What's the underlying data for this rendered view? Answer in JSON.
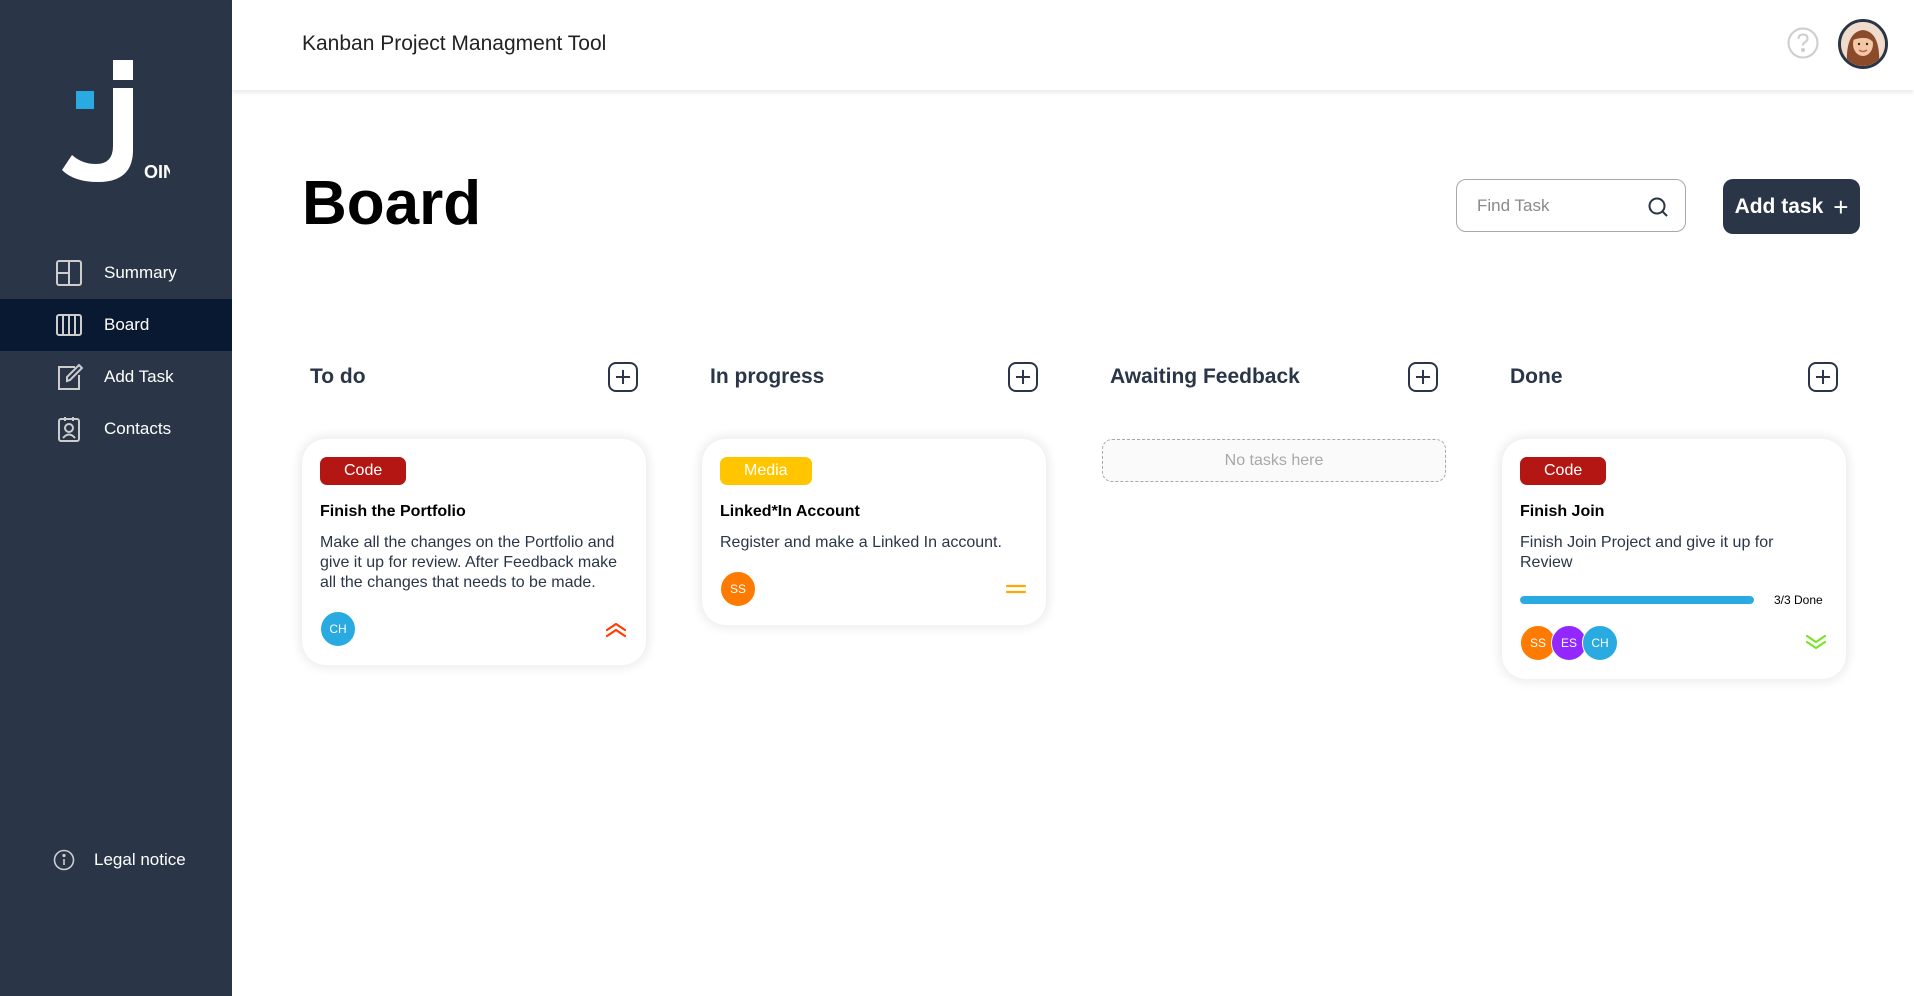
{
  "app": {
    "header_title": "Kanban Project Managment Tool",
    "logo_text": "OIN"
  },
  "colors": {
    "sidebar": "#2a3647",
    "sidebar_active": "#091931",
    "accent_blue": "#29abe2",
    "code_category": "#b41614",
    "media_category": "#ffc600",
    "prio_urgent": "#ff3d00",
    "prio_medium": "#ffa800",
    "prio_low": "#7ae229"
  },
  "sidebar": {
    "items": [
      {
        "label": "Summary",
        "icon": "summary-icon",
        "active": false
      },
      {
        "label": "Board",
        "icon": "board-icon",
        "active": true
      },
      {
        "label": "Add Task",
        "icon": "add-task-icon",
        "active": false
      },
      {
        "label": "Contacts",
        "icon": "contacts-icon",
        "active": false
      }
    ],
    "legal": "Legal notice"
  },
  "board": {
    "title": "Board",
    "search_placeholder": "Find Task",
    "add_task_label": "Add task",
    "columns": [
      {
        "title": "To do",
        "cards": [
          {
            "category": "Code",
            "category_color": "#b41614",
            "title": "Finish the Portfolio",
            "description": "Make all the changes on the Portfolio and give it up for review. After Feedback make all the changes that needs to be made.",
            "assignees": [
              {
                "initials": "CH",
                "color": "#29abe2"
              }
            ],
            "priority": "urgent"
          }
        ]
      },
      {
        "title": "In progress",
        "cards": [
          {
            "category": "Media",
            "category_color": "#ffc600",
            "title": "Linked*In Account",
            "description": "Register and make a Linked In account.",
            "assignees": [
              {
                "initials": "SS",
                "color": "#ff7a00"
              }
            ],
            "priority": "medium"
          }
        ]
      },
      {
        "title": "Awaiting Feedback",
        "empty_text": "No tasks here",
        "cards": []
      },
      {
        "title": "Done",
        "cards": [
          {
            "category": "Code",
            "category_color": "#b41614",
            "title": "Finish Join",
            "description": "Finish Join Project and give it up for Review",
            "progress": 1.0,
            "progress_label": "3/3 Done",
            "assignees": [
              {
                "initials": "SS",
                "color": "#ff7a00"
              },
              {
                "initials": "ES",
                "color": "#9327ff"
              },
              {
                "initials": "CH",
                "color": "#29abe2"
              }
            ],
            "priority": "low"
          }
        ]
      }
    ]
  }
}
